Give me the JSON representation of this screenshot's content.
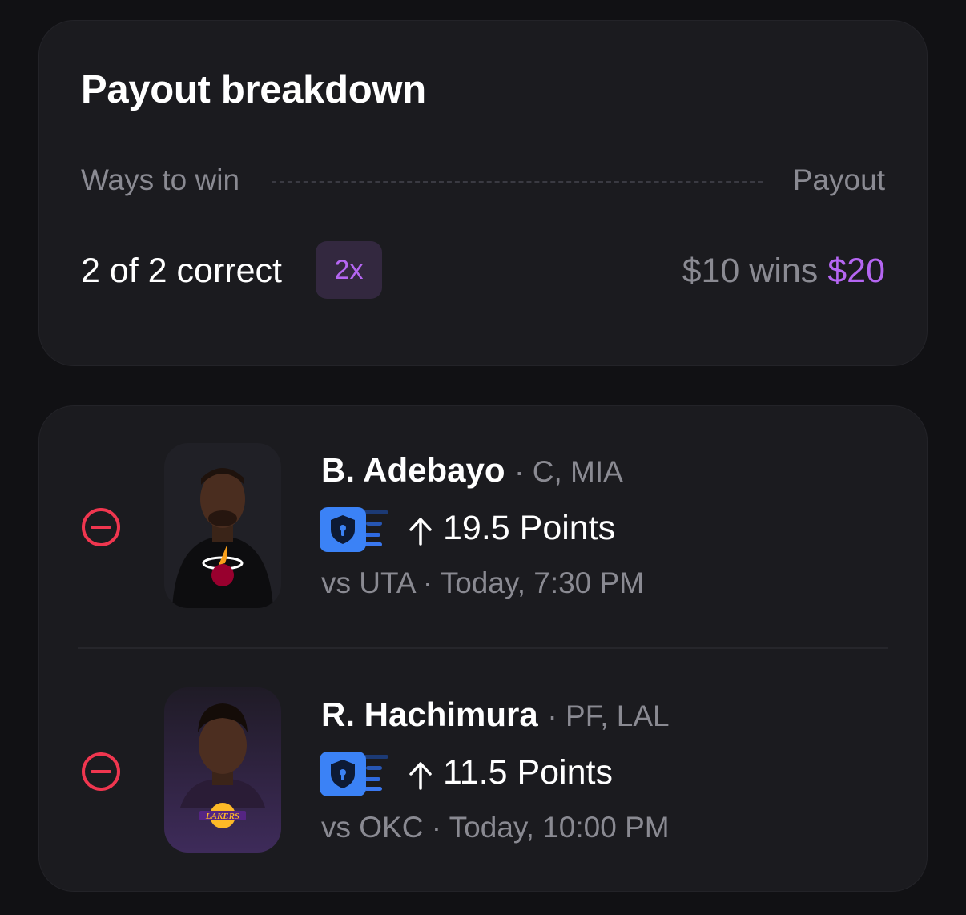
{
  "payout_breakdown": {
    "title": "Payout breakdown",
    "ways_to_win_label": "Ways to win",
    "payout_label": "Payout",
    "correct_text": "2 of 2 correct",
    "multiplier": "2x",
    "stake_text": "$10 wins",
    "win_amount": "$20",
    "accent_color": "#b566f2"
  },
  "picks": [
    {
      "name": "B. Adebayo",
      "position_team": "· C, MIA",
      "prop": "19.5 Points",
      "direction": "up-arrow-icon",
      "game": "vs UTA · Today, 7:30 PM"
    },
    {
      "name": "R. Hachimura",
      "position_team": "· PF, LAL",
      "prop": "11.5 Points",
      "direction": "up-arrow-icon",
      "game": "vs OKC · Today, 10:00 PM"
    }
  ]
}
